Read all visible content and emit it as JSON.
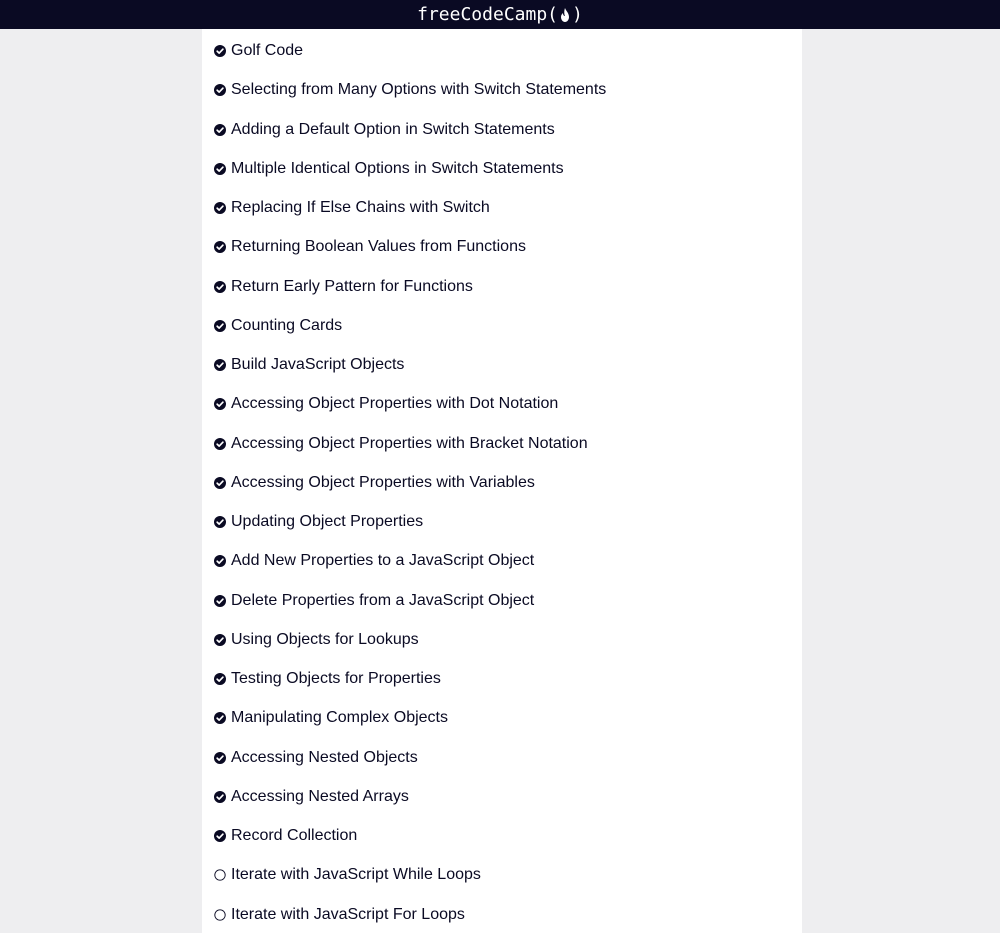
{
  "header": {
    "logo_text_left": "freeCodeCamp(",
    "logo_text_right": ")",
    "logo_icon": "flame-icon"
  },
  "colors": {
    "navbar": "#0a0a23",
    "panel": "#ffffff",
    "background": "#eeeef0",
    "text": "#0a0a23"
  },
  "challenges": [
    {
      "title": "Golf Code",
      "completed": true
    },
    {
      "title": "Selecting from Many Options with Switch Statements",
      "completed": true
    },
    {
      "title": "Adding a Default Option in Switch Statements",
      "completed": true
    },
    {
      "title": "Multiple Identical Options in Switch Statements",
      "completed": true
    },
    {
      "title": "Replacing If Else Chains with Switch",
      "completed": true
    },
    {
      "title": "Returning Boolean Values from Functions",
      "completed": true
    },
    {
      "title": "Return Early Pattern for Functions",
      "completed": true
    },
    {
      "title": "Counting Cards",
      "completed": true
    },
    {
      "title": "Build JavaScript Objects",
      "completed": true
    },
    {
      "title": "Accessing Object Properties with Dot Notation",
      "completed": true
    },
    {
      "title": "Accessing Object Properties with Bracket Notation",
      "completed": true
    },
    {
      "title": "Accessing Object Properties with Variables",
      "completed": true
    },
    {
      "title": "Updating Object Properties",
      "completed": true
    },
    {
      "title": "Add New Properties to a JavaScript Object",
      "completed": true
    },
    {
      "title": "Delete Properties from a JavaScript Object",
      "completed": true
    },
    {
      "title": "Using Objects for Lookups",
      "completed": true
    },
    {
      "title": "Testing Objects for Properties",
      "completed": true
    },
    {
      "title": "Manipulating Complex Objects",
      "completed": true
    },
    {
      "title": "Accessing Nested Objects",
      "completed": true
    },
    {
      "title": "Accessing Nested Arrays",
      "completed": true
    },
    {
      "title": "Record Collection",
      "completed": true
    },
    {
      "title": "Iterate with JavaScript While Loops",
      "completed": false
    },
    {
      "title": "Iterate with JavaScript For Loops",
      "completed": false
    }
  ]
}
